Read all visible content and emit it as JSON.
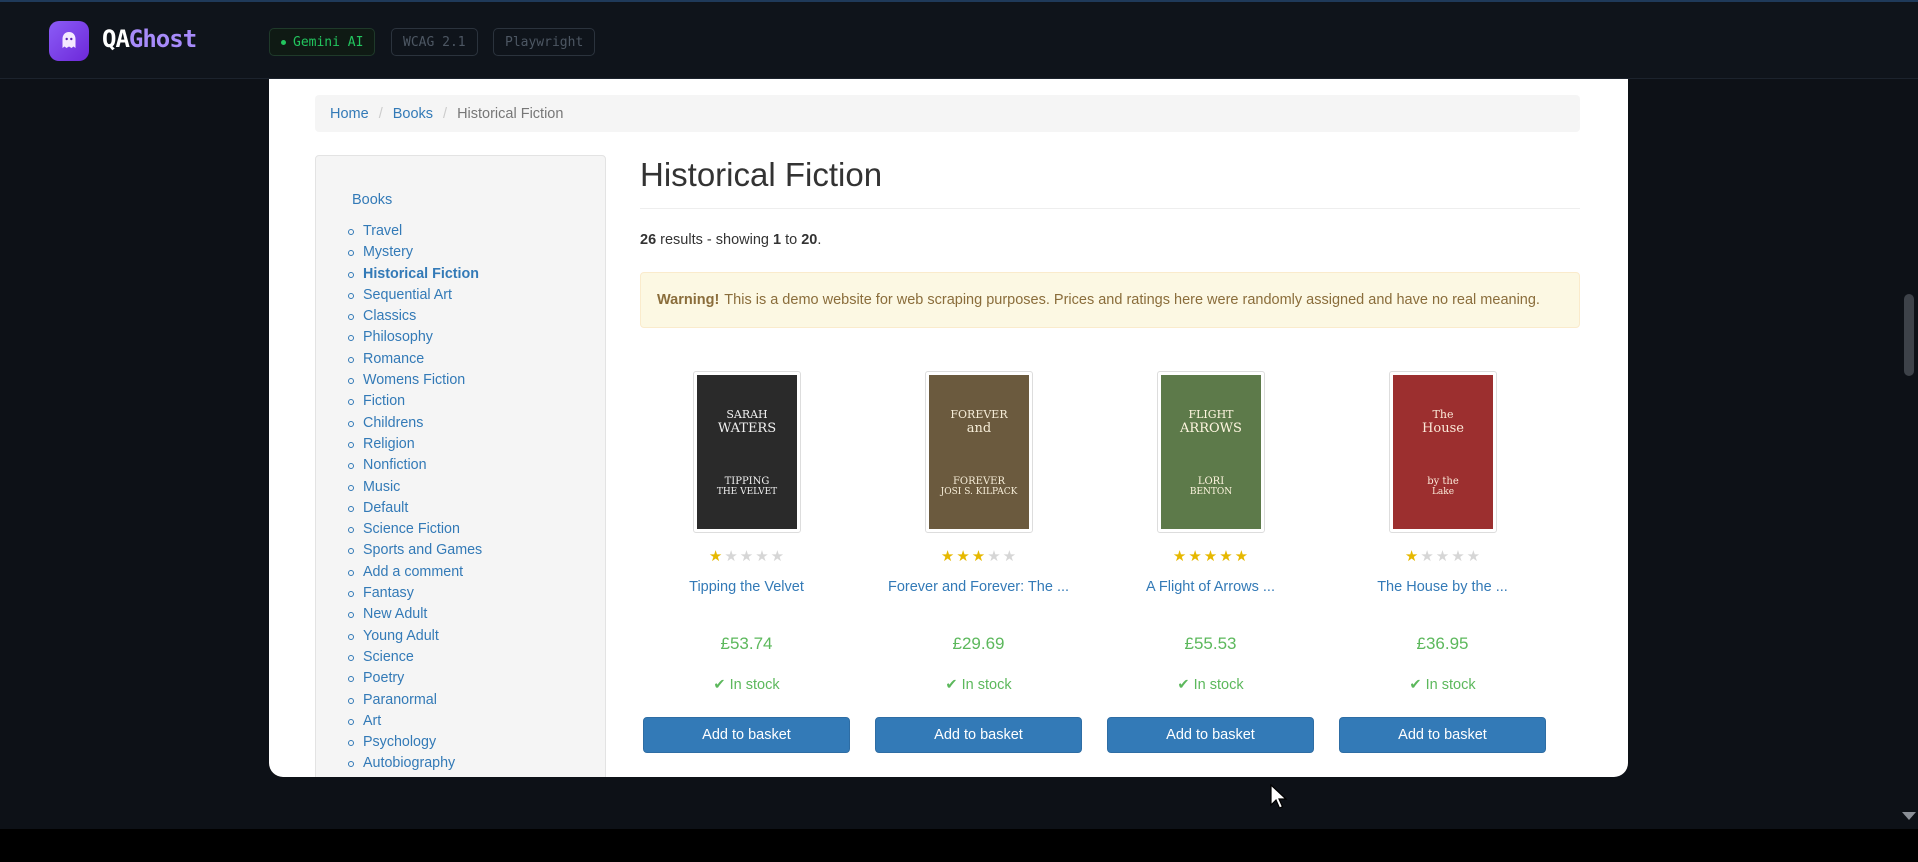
{
  "app": {
    "name_main": "QA",
    "name_accent": "Ghost",
    "chips": {
      "ai": "Gemini AI",
      "wcag": "WCAG 2.1",
      "pw": "Playwright"
    }
  },
  "breadcrumb": {
    "home": "Home",
    "books": "Books",
    "current": "Historical Fiction"
  },
  "sidebar": {
    "heading": "Books",
    "categories": [
      "Travel",
      "Mystery",
      "Historical Fiction",
      "Sequential Art",
      "Classics",
      "Philosophy",
      "Romance",
      "Womens Fiction",
      "Fiction",
      "Childrens",
      "Religion",
      "Nonfiction",
      "Music",
      "Default",
      "Science Fiction",
      "Sports and Games",
      "Add a comment",
      "Fantasy",
      "New Adult",
      "Young Adult",
      "Science",
      "Poetry",
      "Paranormal",
      "Art",
      "Psychology",
      "Autobiography"
    ],
    "active": "Historical Fiction"
  },
  "main": {
    "title": "Historical Fiction",
    "results": {
      "total": "26",
      "text1": " results - showing ",
      "from": "1",
      "to_word": " to ",
      "to": "20",
      "end": "."
    },
    "warning": {
      "label": "Warning!",
      "text": "This is a demo website for web scraping purposes. Prices and ratings here were randomly assigned and have no real meaning."
    }
  },
  "products": [
    {
      "title": "Tipping the Velvet",
      "price": "£53.74",
      "stock": "In stock",
      "rating": 1,
      "button": "Add to basket",
      "cover": {
        "bg": "#2a2a2a",
        "fg": "#f0f0f0",
        "line1": "SARAH",
        "line2": "WATERS",
        "line3": "TIPPING",
        "line4": "THE VELVET"
      }
    },
    {
      "title": "Forever and Forever: The ...",
      "price": "£29.69",
      "stock": "In stock",
      "rating": 3,
      "button": "Add to basket",
      "cover": {
        "bg": "#6b5a3e",
        "fg": "#f5ecd7",
        "line1": "FOREVER",
        "line2": "and",
        "line3": "FOREVER",
        "line4": "JOSI S. KILPACK"
      }
    },
    {
      "title": "A Flight of Arrows ...",
      "price": "£55.53",
      "stock": "In stock",
      "rating": 5,
      "button": "Add to basket",
      "cover": {
        "bg": "#5d7a4a",
        "fg": "#fff6e0",
        "line1": "FLIGHT",
        "line2": "ARROWS",
        "line3": "LORI",
        "line4": "BENTON"
      }
    },
    {
      "title": "The House by the ...",
      "price": "£36.95",
      "stock": "In stock",
      "rating": 1,
      "button": "Add to basket",
      "cover": {
        "bg": "#9c2f2f",
        "fg": "#fbe9d9",
        "line1": "The",
        "line2": "House",
        "line3": "by the",
        "line4": "Lake"
      }
    }
  ]
}
